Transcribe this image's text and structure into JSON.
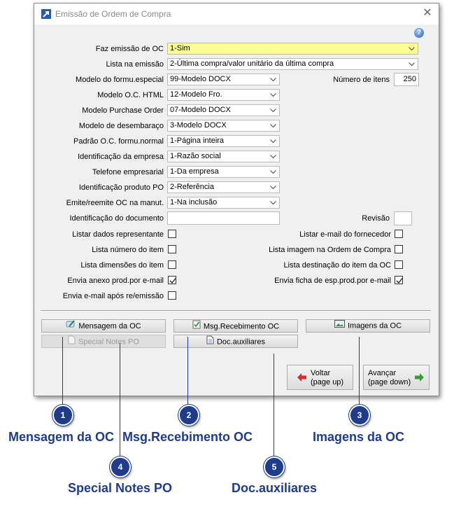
{
  "window": {
    "title": "Emissão de Ordem de Compra",
    "close_glyph": "✕",
    "help_glyph": "?"
  },
  "form": {
    "faz_emissao": {
      "label": "Faz emissão de OC",
      "value": "1-Sim"
    },
    "lista_emissao": {
      "label": "Lista na emissão",
      "value": "2-Última compra/valor unitário da última compra"
    },
    "modelo_formu": {
      "label": "Modelo do formu.especial",
      "value": "99-Modelo DOCX"
    },
    "numero_itens": {
      "label": "Número de itens",
      "value": "250"
    },
    "modelo_oc_html": {
      "label": "Modelo O.C. HTML",
      "value": "12-Modelo Fro."
    },
    "modelo_purchase": {
      "label": "Modelo Purchase Order",
      "value": "07-Modelo DOCX"
    },
    "modelo_desembaraco": {
      "label": "Modelo de desembaraço",
      "value": "3-Modelo DOCX"
    },
    "padrao_oc": {
      "label": "Padrão O.C. formu.normal",
      "value": "1-Página inteira"
    },
    "ident_empresa": {
      "label": "Identificação da empresa",
      "value": "1-Razão social"
    },
    "telefone": {
      "label": "Telefone empresarial",
      "value": "1-Da empresa"
    },
    "ident_produto": {
      "label": "Identificação produto PO",
      "value": "2-Referência"
    },
    "emite_reemite": {
      "label": "Emite/reemite OC na manut.",
      "value": "1-Na inclusão"
    },
    "ident_documento": {
      "label": "Identificação do documento",
      "value": ""
    },
    "revisao": {
      "label": "Revisão",
      "value": ""
    }
  },
  "checks": {
    "listar_representante": {
      "label": "Listar dados representante",
      "checked": false
    },
    "lista_numero_item": {
      "label": "Lista número do item",
      "checked": false
    },
    "lista_dimensoes": {
      "label": "Lista dimensões do item",
      "checked": false
    },
    "envia_anexo": {
      "label": "Envia anexo prod.por e-mail",
      "checked": true
    },
    "envia_email_apos": {
      "label": "Envia e-mail após re/emissão",
      "checked": false
    },
    "listar_email_fornecedor": {
      "label": "Listar e-mail do fornecedor",
      "checked": false
    },
    "lista_imagem": {
      "label": "Lista imagem na Ordem de Compra",
      "checked": false
    },
    "lista_destinacao": {
      "label": "Lista destinação do item da OC",
      "checked": false
    },
    "envia_ficha": {
      "label": "Envia ficha de esp.prod.por e-mail",
      "checked": true
    }
  },
  "buttons": {
    "mensagem": "Mensagem da OC",
    "msg_recebimento": "Msg.Recebimento OC",
    "imagens": "Imagens da OC",
    "special_notes": "Special Notes PO",
    "doc_auxiliares": "Doc.auxiliares",
    "voltar_1": "Voltar",
    "voltar_2": "(page up)",
    "avancar_1": "Avançar",
    "avancar_2": "(page down)"
  },
  "callouts": [
    {
      "num": "1",
      "caption": "Mensagem da OC"
    },
    {
      "num": "2",
      "caption": "Msg.Recebimento OC"
    },
    {
      "num": "3",
      "caption": "Imagens da OC"
    },
    {
      "num": "4",
      "caption": "Special Notes PO"
    },
    {
      "num": "5",
      "caption": "Doc.auxiliares"
    }
  ],
  "colors": {
    "highlight_field": "#fdfd96",
    "callout_blue": "#1f3b8c",
    "arrow_red": "#d03030",
    "arrow_green": "#3a9a3a"
  }
}
